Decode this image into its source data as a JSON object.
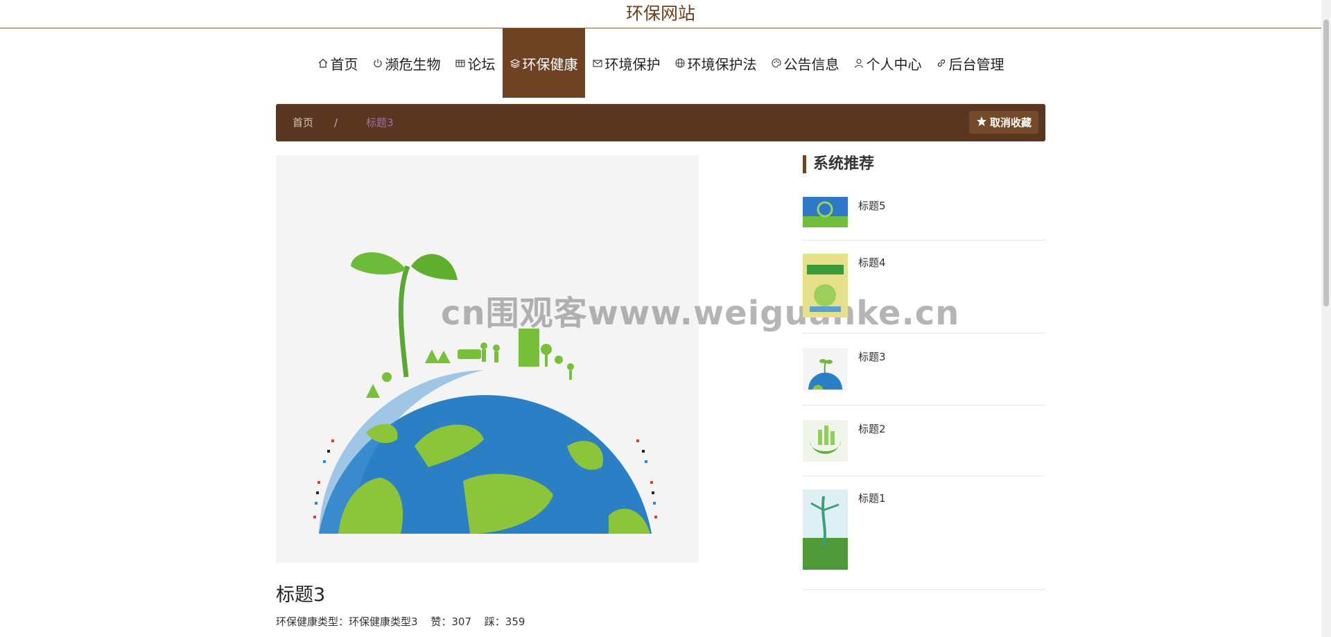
{
  "site": {
    "title": "环保网站"
  },
  "nav": {
    "items": [
      {
        "label": "首页",
        "icon": "home-icon",
        "active": false
      },
      {
        "label": "濒危生物",
        "icon": "power-icon",
        "active": false
      },
      {
        "label": "论坛",
        "icon": "grid-icon",
        "active": false
      },
      {
        "label": "环保健康",
        "icon": "layers-icon",
        "active": true
      },
      {
        "label": "环境保护",
        "icon": "mail-icon",
        "active": false
      },
      {
        "label": "环境保护法",
        "icon": "globe-icon",
        "active": false
      },
      {
        "label": "公告信息",
        "icon": "palette-icon",
        "active": false
      },
      {
        "label": "个人中心",
        "icon": "user-icon",
        "active": false
      },
      {
        "label": "后台管理",
        "icon": "link-icon",
        "active": false
      }
    ]
  },
  "breadcrumb": {
    "home": "首页",
    "separator": "/",
    "current": "标题3"
  },
  "favorite": {
    "label": "取消收藏",
    "icon": "star-icon"
  },
  "article": {
    "title": "标题3",
    "type_label": "环保健康类型：",
    "type_value": "环保健康类型3",
    "likes_label": "赞：",
    "likes": "307",
    "dislikes_label": "踩：",
    "dislikes": "359"
  },
  "watermark": "cn围观客www.weiguanke.cn",
  "sidebar": {
    "title": "系统推荐",
    "items": [
      {
        "label": "标题5"
      },
      {
        "label": "标题4"
      },
      {
        "label": "标题3"
      },
      {
        "label": "标题2"
      },
      {
        "label": "标题1"
      }
    ]
  },
  "colors": {
    "brand": "#6e4323",
    "bar": "#5a3520",
    "current_crumb": "#a36fae"
  }
}
